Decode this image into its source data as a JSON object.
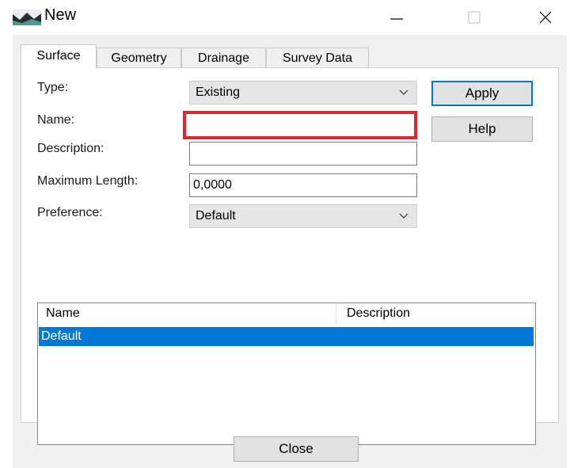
{
  "window": {
    "title": "New"
  },
  "tabs": [
    {
      "label": "Surface",
      "active": true
    },
    {
      "label": "Geometry"
    },
    {
      "label": "Drainage"
    },
    {
      "label": "Survey Data"
    }
  ],
  "form": {
    "type_label": "Type:",
    "type_value": "Existing",
    "name_label": "Name:",
    "name_value": "",
    "description_label": "Description:",
    "description_value": "",
    "max_length_label": "Maximum Length:",
    "max_length_value": "0,0000",
    "preference_label": "Preference:",
    "preference_value": "Default"
  },
  "buttons": {
    "apply": "Apply",
    "help": "Help",
    "close": "Close"
  },
  "list": {
    "columns": [
      "Name",
      "Description"
    ],
    "rows": [
      {
        "name": "Default",
        "description": ""
      }
    ]
  },
  "colors": {
    "selection": "#0078d7",
    "highlight": "#e0252d",
    "dialog_bg": "#f0f0f0"
  },
  "icons": {
    "app": "surface-landscape-icon",
    "minimize": "minimize-icon",
    "maximize": "maximize-icon",
    "close": "close-icon",
    "dropdown": "chevron-down-icon"
  }
}
